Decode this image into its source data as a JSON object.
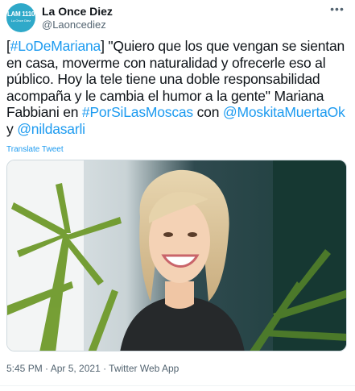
{
  "author": {
    "display_name": "La Once Diez",
    "handle": "@Laoncediez",
    "avatar_text_top": "LAM 1110",
    "avatar_text_bottom": "La Once Diez"
  },
  "tweet": {
    "seg1": "[",
    "hashtag1": "#LoDeMariana",
    "seg2": "] \"Quiero que los que vengan se sientan en casa, moverme con naturalidad y ofrecerle eso al público. Hoy la tele tiene una doble responsabilidad acompaña y le cambia el humor a la gente\" Mariana Fabbiani en ",
    "hashtag2": "#PorSiLasMoscas",
    "seg3": " con ",
    "mention1": "@MoskitaMuertaOk",
    "seg4": " y ",
    "mention2": "@nildasarli",
    "translate_label": "Translate Tweet"
  },
  "footer": {
    "timestamp": "5:45 PM · Apr 5, 2021 · Twitter Web App"
  },
  "colors": {
    "link": "#1d9bf0",
    "avatar_bg": "#2fa9c9"
  },
  "icons": {
    "more": "more-horizontal-icon"
  }
}
